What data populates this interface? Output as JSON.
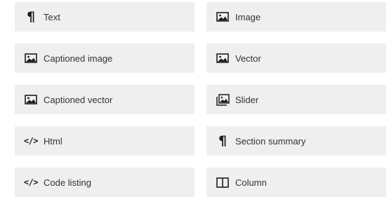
{
  "blocks": [
    {
      "label": "Text",
      "icon": "paragraph-icon"
    },
    {
      "label": "Image",
      "icon": "image-icon"
    },
    {
      "label": "Captioned image",
      "icon": "image-icon"
    },
    {
      "label": "Vector",
      "icon": "image-icon"
    },
    {
      "label": "Captioned vector",
      "icon": "image-icon"
    },
    {
      "label": "Slider",
      "icon": "slider-icon"
    },
    {
      "label": "Html",
      "icon": "code-icon"
    },
    {
      "label": "Section summary",
      "icon": "paragraph-icon"
    },
    {
      "label": "Code listing",
      "icon": "code-icon"
    },
    {
      "label": "Column",
      "icon": "column-icon"
    }
  ],
  "colors": {
    "tile_background": "#efefef",
    "text": "#333333",
    "icon": "#1d1d1d"
  }
}
